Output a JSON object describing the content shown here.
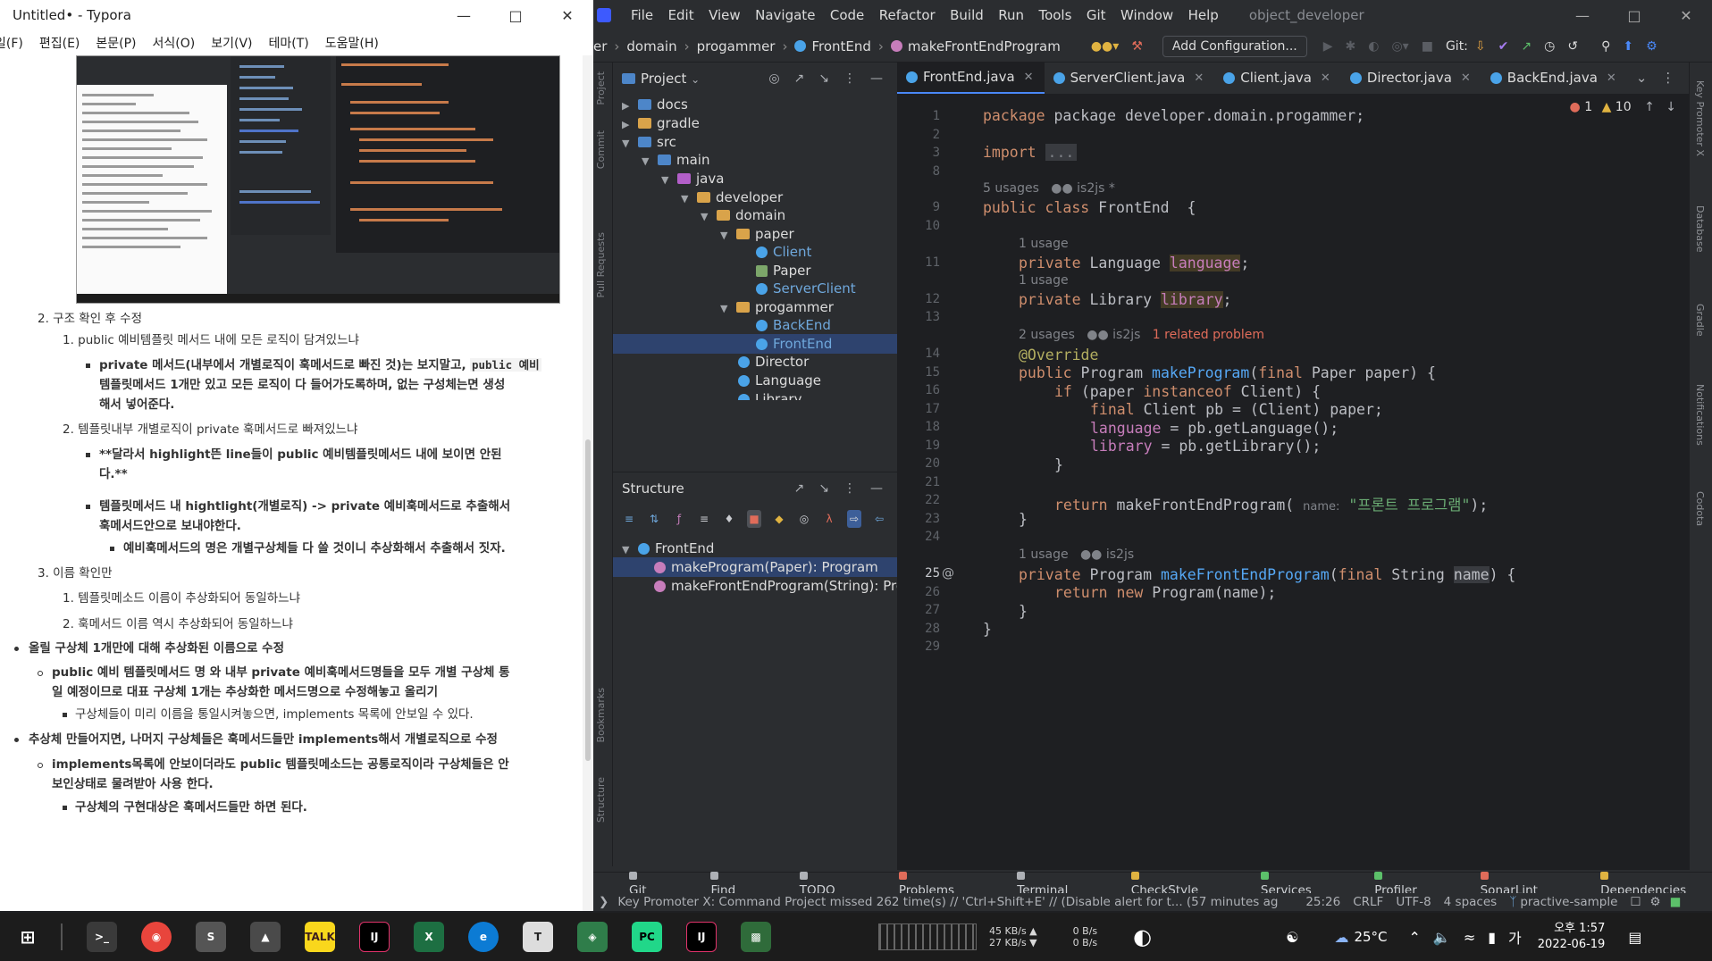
{
  "typora": {
    "title": "Untitled• - Typora",
    "menu": [
      "일(F)",
      "편집(E)",
      "본문(P)",
      "서식(O)",
      "보기(V)",
      "테마(T)",
      "도움말(H)"
    ],
    "lines": {
      "l1": "2. 구조 확인 후 수정",
      "l2": "1. public 예비템플릿 메서드 내에 모든 로직이 담겨있느냐",
      "l3a": "private 메서드(내부에서 개별로직이 훅메서드로 빠진 것)는 보지말고,",
      "l3b": "public 예비",
      "l4": "템플릿메서드 1개만 있고 모든 로직이 다 들어가도록하며, 없는 구성체는면 생성",
      "l5": "해서 넣어준다.",
      "l6": "2. 템플릿내부 개별로직이 private 훅메서드로 빠져있느냐",
      "l7": "**달라서 highlight뜬 line들이 public 예비템플릿메서드 내에 보이면 안된",
      "l8": "다.**",
      "l9": "템플릿메서드 내 hightlight(개별로직) -> private 예비훅메서드로 추출해서",
      "l10": "훅메서드안으로 보내야한다.",
      "l11": "예비훅메서드의 명은 개별구상체들 다 쓸 것이니 추상화해서 추출해서 짓자.",
      "l12": "3. 이름 확인만",
      "l13": "1. 템플릿메소드 이름이 추상화되어 동일하느냐",
      "l14": "2. 훅메서드 이름 역시 추상화되어 동일하느냐",
      "l15": "올릴 구상체 1개만에 대해 추상화된 이름으로 수정",
      "l16": "public 예비 템플릿메서드 명 와 내부 private 예비훅메서드명들을 모두 개별 구상체 통",
      "l17": "일 예정이므로 대표 구상체 1개는 추상화한 메서드명으로 수정해놓고 올리기",
      "l18": "구상체들이 미리 이름을 통일시켜놓으면, implements 목록에 안보일 수 있다.",
      "l19": "추상체 만들어지면, 나머지 구상체들은 훅메서드들만 implements해서 개별로직으로 수정",
      "l20": "implements목록에 안보이더라도 public 템플릿메소드는 공통로직이라 구상체들은 안",
      "l21": "보인상태로 물려받아 사용 한다.",
      "l22": "구상체의 구현대상은 훅메서드들만 하면 된다."
    }
  },
  "ide": {
    "menu": [
      "File",
      "Edit",
      "View",
      "Navigate",
      "Code",
      "Refactor",
      "Build",
      "Run",
      "Tools",
      "Git",
      "Window",
      "Help"
    ],
    "project_name": "object_developer",
    "breadcrumb": [
      "er",
      "domain",
      "progammer",
      "FrontEnd",
      "makeFrontEndProgram"
    ],
    "add_configuration": "Add Configuration...",
    "git_label": "Git:",
    "project_panel": {
      "title": "Project",
      "items": [
        "docs",
        "gradle",
        "src",
        "main",
        "java",
        "developer",
        "domain",
        "paper",
        "Client",
        "Paper",
        "ServerClient",
        "progammer",
        "BackEnd",
        "FrontEnd",
        "Director",
        "Language",
        "Library"
      ]
    },
    "structure_panel": {
      "title": "Structure",
      "root": "FrontEnd",
      "members": [
        "makeProgram(Paper): Program",
        "makeFrontEndProgram(String): Program"
      ]
    },
    "tabs": [
      "FrontEnd.java",
      "ServerClient.java",
      "Client.java",
      "Director.java",
      "BackEnd.java"
    ],
    "inspection": {
      "errors": "1",
      "warnings": "10"
    },
    "line_numbers": [
      "1",
      "2",
      "3",
      "8",
      "9",
      "10",
      "11",
      "12",
      "13",
      "14",
      "15",
      "16",
      "17",
      "18",
      "19",
      "20",
      "21",
      "22",
      "23",
      "24",
      "25",
      "26",
      "27",
      "28",
      "29"
    ],
    "hints": {
      "h1": "5 usages",
      "h1_author": "is2js *",
      "h2": "1 usage",
      "h3": "1 usage",
      "h4": "2 usages",
      "h4_author": "is2js",
      "h4_problem": "1 related problem",
      "h5": "1 usage",
      "h5_author": "is2js"
    },
    "code": {
      "c1": "package developer.domain.progammer;",
      "c3a": "import",
      "c3b": "...",
      "c9": "FrontEnd",
      "c11": "language",
      "c12": "library",
      "c14": "@Override",
      "c15": "makeProgram",
      "c22_param": "name:",
      "c22_str": "\"프론트 프로그램\"",
      "c25": "makeFrontEndProgram",
      "c25_param": "name",
      "c26": "Program(name);"
    },
    "tool_windows": [
      "Git",
      "Find",
      "TODO",
      "Problems",
      "Terminal",
      "CheckStyle",
      "Services",
      "Profiler",
      "SonarLint",
      "Dependencies"
    ],
    "status": {
      "message": "Key Promoter X: Command Project missed 262 time(s) // 'Ctrl+Shift+E' // (Disable alert for t... (57 minutes ag",
      "position": "25:26",
      "line_sep": "CRLF",
      "encoding": "UTF-8",
      "indent": "4 spaces",
      "branch": "practive-sample"
    },
    "right_strip": [
      "Key Promoter X",
      "Database",
      "Gradle",
      "Notifications",
      "Codota"
    ],
    "left_strip": [
      "Project",
      "Commit",
      "Pull Requests",
      "Bookmarks",
      "Structure"
    ]
  },
  "taskbar": {
    "net_up": "45 KB/s ▲",
    "net_down": "27 KB/s ▼",
    "net2_up": "0 B/s",
    "net2_down": "0 B/s",
    "temp": "25°C",
    "ime": "가",
    "time": "오후 1:57",
    "date": "2022-06-19"
  }
}
